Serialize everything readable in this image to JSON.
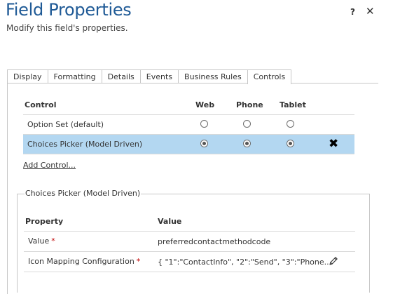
{
  "dialog": {
    "title": "Field Properties",
    "subtitle": "Modify this field's properties.",
    "help_label": "?",
    "close_label": "✕"
  },
  "tabs": [
    {
      "label": "Display"
    },
    {
      "label": "Formatting"
    },
    {
      "label": "Details"
    },
    {
      "label": "Events"
    },
    {
      "label": "Business Rules"
    },
    {
      "label": "Controls",
      "active": true
    }
  ],
  "controls_table": {
    "headers": {
      "control": "Control",
      "web": "Web",
      "phone": "Phone",
      "tablet": "Tablet"
    },
    "rows": [
      {
        "name": "Option Set (default)",
        "web": false,
        "phone": false,
        "tablet": false,
        "selected": false
      },
      {
        "name": "Choices Picker (Model Driven)",
        "web": true,
        "phone": true,
        "tablet": true,
        "selected": true
      }
    ],
    "remove_icon": "✖"
  },
  "add_control_label": "Add Control...",
  "properties_group": {
    "legend": "Choices Picker (Model Driven)",
    "headers": {
      "property": "Property",
      "value": "Value"
    },
    "rows": [
      {
        "property": "Value",
        "required_mark": "*",
        "value": "preferredcontactmethodcode"
      },
      {
        "property": "Icon Mapping Configuration",
        "required_mark": "*",
        "value": "{ \"1\":\"ContactInfo\", \"2\":\"Send\", \"3\":\"Phone..."
      }
    ]
  },
  "colors": {
    "title": "#1f5a96",
    "selected_row": "#b3d7f1",
    "required": "#c00000"
  }
}
